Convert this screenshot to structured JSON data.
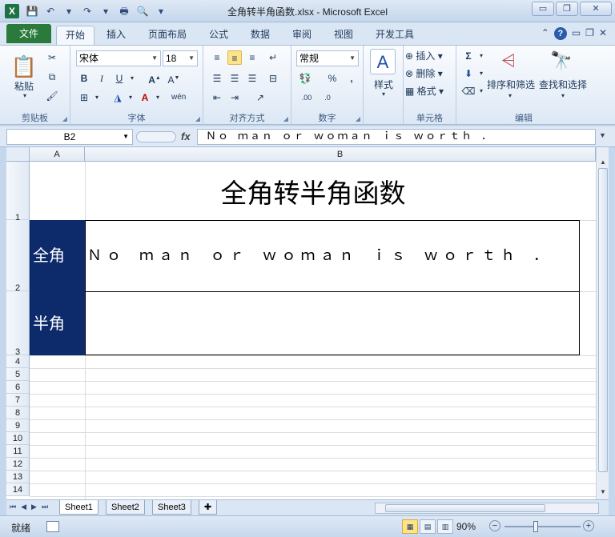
{
  "window": {
    "title": "全角转半角函数.xlsx - Microsoft Excel",
    "app_icon": "X",
    "minimize": "▭",
    "restore": "❐",
    "close": "✕"
  },
  "qat": {
    "save_icon": "💾",
    "undo_icon": "↶",
    "redo_icon": "↷",
    "print_icon": "🖶",
    "preview_icon": "🔍",
    "customize_icon": "▾"
  },
  "tabs": {
    "file": "文件",
    "items": [
      "开始",
      "插入",
      "页面布局",
      "公式",
      "数据",
      "审阅",
      "视图",
      "开发工具"
    ],
    "active": "开始"
  },
  "ribbon": {
    "clipboard": {
      "label": "剪贴板",
      "paste": "粘贴"
    },
    "font": {
      "label": "字体",
      "name": "宋体",
      "size": "18",
      "bold": "B",
      "italic": "I",
      "underline": "U"
    },
    "alignment": {
      "label": "对齐方式"
    },
    "number": {
      "label": "数字",
      "format": "常规",
      "percent": "%",
      "comma": ","
    },
    "styles": {
      "label": "样式"
    },
    "cells": {
      "label": "单元格",
      "insert": "插入",
      "delete": "删除",
      "format": "格式"
    },
    "editing": {
      "label": "编辑",
      "sort": "排序和筛选",
      "find": "查找和选择"
    }
  },
  "formula_bar": {
    "name_box": "B2",
    "fx": "fx",
    "content": "Ｎｏ ｍａｎ ｏｒ ｗｏｍａｎ ｉｓ ｗｏｒｔｈ ．"
  },
  "sheet": {
    "columns": [
      "A",
      "B"
    ],
    "rows": [
      "1",
      "2",
      "3",
      "4",
      "5",
      "6",
      "7",
      "8",
      "9",
      "10",
      "11",
      "12",
      "13",
      "14"
    ],
    "title": "全角转半角函数",
    "label_full": "全角",
    "label_half": "半角",
    "value_full": "Ｎｏ ｍａｎ ｏｒ ｗｏｍａｎ ｉｓ ｗｏｒｔｈ ．",
    "value_half": ""
  },
  "sheet_tabs": [
    "Sheet1",
    "Sheet2",
    "Sheet3"
  ],
  "status": {
    "ready": "就绪",
    "zoom": "90%"
  }
}
